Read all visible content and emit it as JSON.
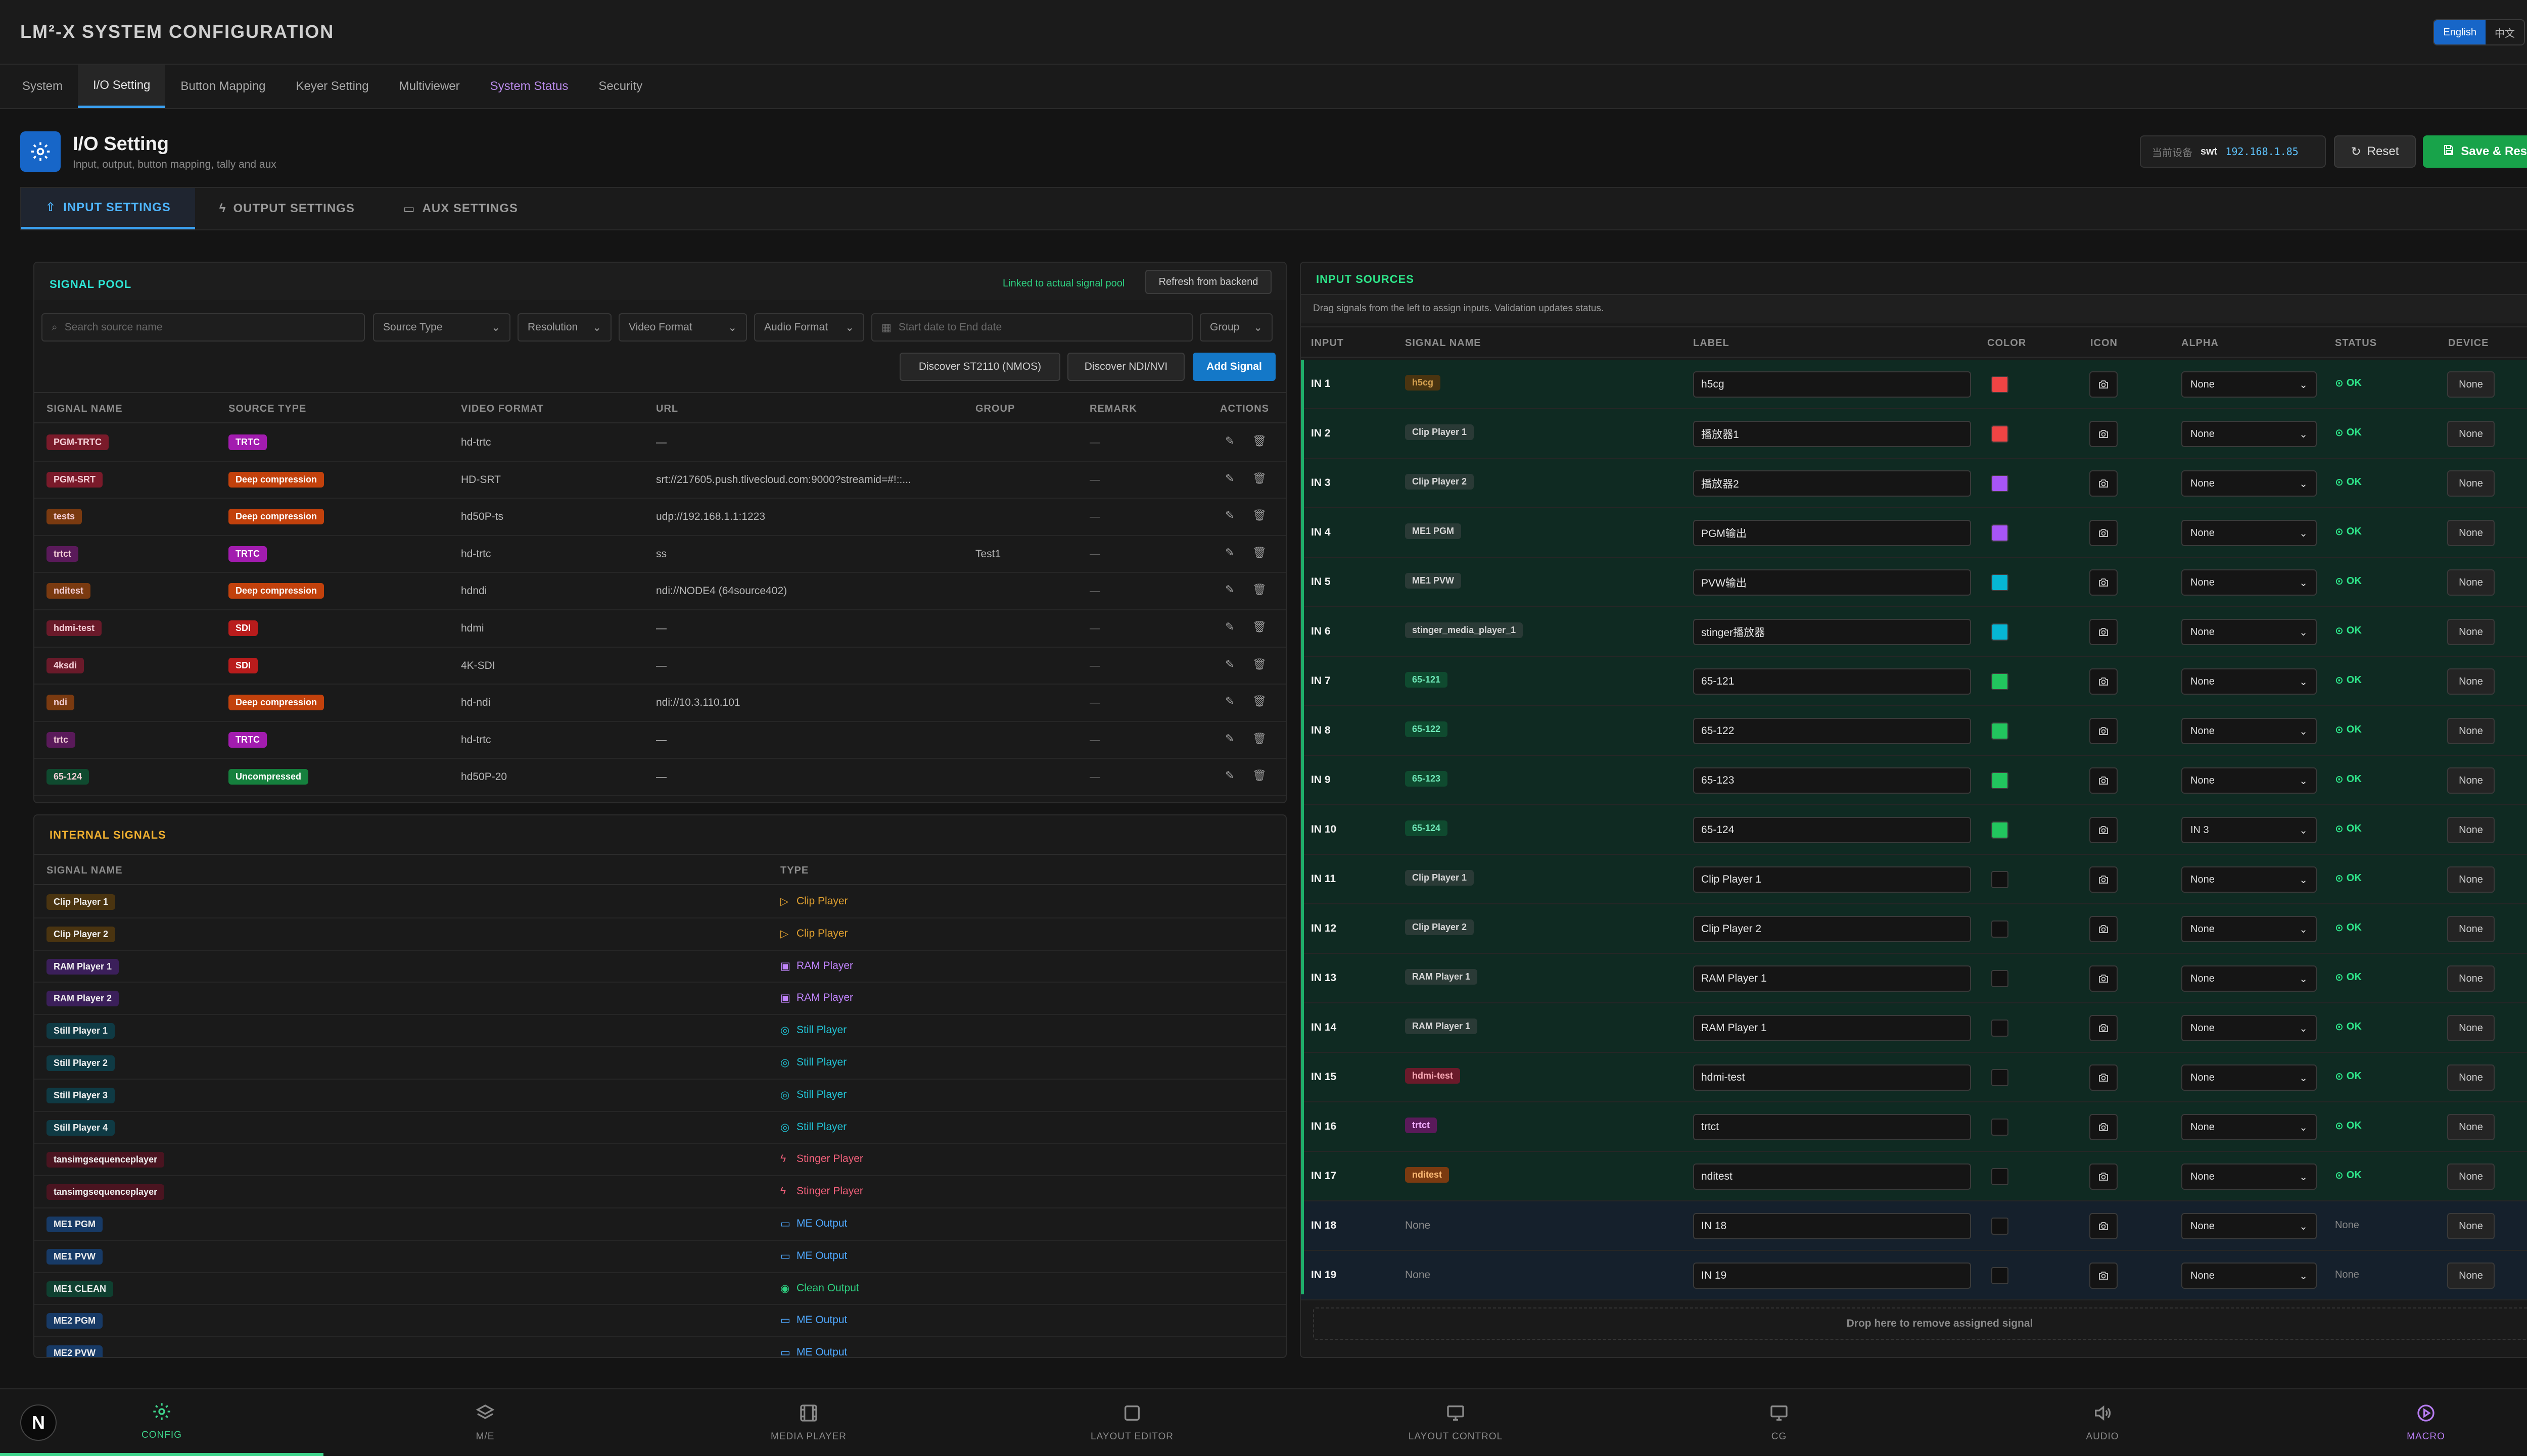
{
  "app": {
    "title": "LM²-X SYSTEM CONFIGURATION",
    "lang": [
      "English",
      "中文"
    ],
    "lang_active": "English"
  },
  "tabs": [
    "System",
    "I/O Setting",
    "Button Mapping",
    "Keyer Setting",
    "Multiviewer",
    "System Status",
    "Security"
  ],
  "tab_active": "I/O Setting",
  "page": {
    "title": "I/O Setting",
    "subtitle": "Input, output, button mapping, tally and aux",
    "device_label": "当前设备",
    "device": "swt",
    "ip": "192.168.1.85",
    "reset": "Reset",
    "save": "Save & Restart"
  },
  "subtabs": [
    "INPUT SETTINGS",
    "OUTPUT SETTINGS",
    "AUX SETTINGS"
  ],
  "signal_pool": {
    "title": "SIGNAL POOL",
    "linked": "Linked to actual signal pool",
    "refresh": "Refresh from backend",
    "search_placeholder": "Search source name",
    "filters": {
      "source_type": "Source Type",
      "resolution": "Resolution",
      "video_format": "Video Format",
      "audio_format": "Audio Format",
      "date": "Start date to End date",
      "group": "Group"
    },
    "buttons": {
      "discover_st": "Discover ST2110 (NMOS)",
      "discover_ndi": "Discover NDI/NVI",
      "add": "Add Signal"
    },
    "columns": [
      "SIGNAL NAME",
      "SOURCE TYPE",
      "VIDEO FORMAT",
      "URL",
      "GROUP",
      "REMARK",
      "ACTIONS"
    ],
    "rows": [
      {
        "name": "PGM-TRTC",
        "name_color": "#7a1a2a",
        "type": "TRTC",
        "type_color": "#a21caf",
        "format": "hd-trtc",
        "url": "—",
        "group": "",
        "remark": "—"
      },
      {
        "name": "PGM-SRT",
        "name_color": "#7a1a2a",
        "type": "Deep compression",
        "type_color": "#c2410c",
        "format": "HD-SRT",
        "url": "srt://217605.push.tlivecloud.com:9000?streamid=#!::...",
        "group": "",
        "remark": "—"
      },
      {
        "name": "tests",
        "name_color": "#7a3a10",
        "type": "Deep compression",
        "type_color": "#c2410c",
        "format": "hd50P-ts",
        "url": "udp://192.168.1.1:1223",
        "group": "",
        "remark": "—"
      },
      {
        "name": "trtct",
        "name_color": "#5a1a5a",
        "type": "TRTC",
        "type_color": "#a21caf",
        "format": "hd-trtc",
        "url": "ss",
        "group": "Test1",
        "remark": "—"
      },
      {
        "name": "nditest",
        "name_color": "#7a3a10",
        "type": "Deep compression",
        "type_color": "#c2410c",
        "format": "hdndi",
        "url": "ndi://NODE4 (64source402)",
        "group": "",
        "remark": "—"
      },
      {
        "name": "hdmi-test",
        "name_color": "#6a1a2a",
        "type": "SDI",
        "type_color": "#b91c1c",
        "format": "hdmi",
        "url": "—",
        "group": "",
        "remark": "—"
      },
      {
        "name": "4ksdi",
        "name_color": "#6a1a2a",
        "type": "SDI",
        "type_color": "#b91c1c",
        "format": "4K-SDI",
        "url": "—",
        "group": "",
        "remark": "—"
      },
      {
        "name": "ndi",
        "name_color": "#7a3a10",
        "type": "Deep compression",
        "type_color": "#c2410c",
        "format": "hd-ndi",
        "url": "ndi://10.3.110.101",
        "group": "",
        "remark": "—"
      },
      {
        "name": "trtc",
        "name_color": "#5a1a5a",
        "type": "TRTC",
        "type_color": "#a21caf",
        "format": "hd-trtc",
        "url": "—",
        "group": "",
        "remark": "—"
      },
      {
        "name": "65-124",
        "name_color": "#0f4a2f",
        "type": "Uncompressed",
        "type_color": "#15803d",
        "format": "hd50P-20",
        "url": "—",
        "group": "",
        "remark": "—"
      }
    ]
  },
  "internal": {
    "title": "INTERNAL SIGNALS",
    "columns": [
      "SIGNAL NAME",
      "TYPE"
    ],
    "rows": [
      {
        "name": "Clip Player 1",
        "type": "Clip Player",
        "color": "#e0a030",
        "bg": "#4a3410",
        "icon": "▷"
      },
      {
        "name": "Clip Player 2",
        "type": "Clip Player",
        "color": "#e0a030",
        "bg": "#4a3410",
        "icon": "▷"
      },
      {
        "name": "RAM Player 1",
        "type": "RAM Player",
        "color": "#c084fc",
        "bg": "#3b1f5a",
        "icon": "▣"
      },
      {
        "name": "RAM Player 2",
        "type": "RAM Player",
        "color": "#c084fc",
        "bg": "#3b1f5a",
        "icon": "▣"
      },
      {
        "name": "Still Player 1",
        "type": "Still Player",
        "color": "#22c4d6",
        "bg": "#0f3a44",
        "icon": "◎"
      },
      {
        "name": "Still Player 2",
        "type": "Still Player",
        "color": "#22c4d6",
        "bg": "#0f3a44",
        "icon": "◎"
      },
      {
        "name": "Still Player 3",
        "type": "Still Player",
        "color": "#22c4d6",
        "bg": "#0f3a44",
        "icon": "◎"
      },
      {
        "name": "Still Player 4",
        "type": "Still Player",
        "color": "#22c4d6",
        "bg": "#0f3a44",
        "icon": "◎"
      },
      {
        "name": "tansimgsequenceplayer",
        "type": "Stinger Player",
        "color": "#f0607a",
        "bg": "#4a1420",
        "icon": "ϟ"
      },
      {
        "name": "tansimgsequenceplayer",
        "type": "Stinger Player",
        "color": "#f0607a",
        "bg": "#4a1420",
        "icon": "ϟ"
      },
      {
        "name": "ME1 PGM",
        "type": "ME Output",
        "color": "#4fa8ff",
        "bg": "#173a66",
        "icon": "▭"
      },
      {
        "name": "ME1 PVW",
        "type": "ME Output",
        "color": "#4fa8ff",
        "bg": "#173a66",
        "icon": "▭"
      },
      {
        "name": "ME1 CLEAN",
        "type": "Clean Output",
        "color": "#2ecf80",
        "bg": "#0f4030",
        "icon": "◉"
      },
      {
        "name": "ME2 PGM",
        "type": "ME Output",
        "color": "#4fa8ff",
        "bg": "#173a66",
        "icon": "▭"
      },
      {
        "name": "ME2 PVW",
        "type": "ME Output",
        "color": "#4fa8ff",
        "bg": "#173a66",
        "icon": "▭"
      }
    ]
  },
  "input_sources": {
    "title": "INPUT SOURCES",
    "hint": "Drag signals from the left to assign inputs. Validation updates status.",
    "columns": [
      "INPUT",
      "SIGNAL NAME",
      "LABEL",
      "COLOR",
      "ICON",
      "ALPHA",
      "STATUS",
      "DEVICE"
    ],
    "drop": "Drop here to remove assigned signal",
    "rows": [
      {
        "input": "IN 1",
        "signal": "h5cg",
        "sig_color": "#d4a050",
        "sig_bg": "#4a3410",
        "label": "h5cg",
        "color": "#ef4444",
        "alpha": "None",
        "status": "OK",
        "device": "None"
      },
      {
        "input": "IN 2",
        "signal": "Clip Player 1",
        "sig_color": "#d6d6d6",
        "sig_bg": "#2a3a36",
        "label": "播放器1",
        "color": "#ef4444",
        "alpha": "None",
        "status": "OK",
        "device": "None"
      },
      {
        "input": "IN 3",
        "signal": "Clip Player 2",
        "sig_color": "#d6d6d6",
        "sig_bg": "#2a3a36",
        "label": "播放器2",
        "color": "#a855f7",
        "alpha": "None",
        "status": "OK",
        "device": "None"
      },
      {
        "input": "IN 4",
        "signal": "ME1 PGM",
        "sig_color": "#d6d6d6",
        "sig_bg": "#2a3a36",
        "label": "PGM输出",
        "color": "#a855f7",
        "alpha": "None",
        "status": "OK",
        "device": "None"
      },
      {
        "input": "IN 5",
        "signal": "ME1 PVW",
        "sig_color": "#d6d6d6",
        "sig_bg": "#2a3a36",
        "label": "PVW输出",
        "color": "#06b6d4",
        "alpha": "None",
        "status": "OK",
        "device": "None"
      },
      {
        "input": "IN 6",
        "signal": "stinger_media_player_1",
        "sig_color": "#d6d6d6",
        "sig_bg": "#2a3a36",
        "label": "stinger播放器",
        "color": "#06b6d4",
        "alpha": "None",
        "status": "OK",
        "device": "None"
      },
      {
        "input": "IN 7",
        "signal": "65-121",
        "sig_color": "#6ee7b7",
        "sig_bg": "#0f4a2f",
        "label": "65-121",
        "color": "#22c55e",
        "alpha": "None",
        "status": "OK",
        "device": "None"
      },
      {
        "input": "IN 8",
        "signal": "65-122",
        "sig_color": "#6ee7b7",
        "sig_bg": "#0f4a2f",
        "label": "65-122",
        "color": "#22c55e",
        "alpha": "None",
        "status": "OK",
        "device": "None"
      },
      {
        "input": "IN 9",
        "signal": "65-123",
        "sig_color": "#6ee7b7",
        "sig_bg": "#0f4a2f",
        "label": "65-123",
        "color": "#22c55e",
        "alpha": "None",
        "status": "OK",
        "device": "None"
      },
      {
        "input": "IN 10",
        "signal": "65-124",
        "sig_color": "#6ee7b7",
        "sig_bg": "#0f4a2f",
        "label": "65-124",
        "color": "#22c55e",
        "alpha": "IN 3",
        "status": "OK",
        "device": "None"
      },
      {
        "input": "IN 11",
        "signal": "Clip Player 1",
        "sig_color": "#d6d6d6",
        "sig_bg": "#2a3a36",
        "label": "Clip Player 1",
        "color": "#111111",
        "alpha": "None",
        "status": "OK",
        "device": "None"
      },
      {
        "input": "IN 12",
        "signal": "Clip Player 2",
        "sig_color": "#d6d6d6",
        "sig_bg": "#2a3a36",
        "label": "Clip Player 2",
        "color": "#111111",
        "alpha": "None",
        "status": "OK",
        "device": "None"
      },
      {
        "input": "IN 13",
        "signal": "RAM Player 1",
        "sig_color": "#d6d6d6",
        "sig_bg": "#2a3a36",
        "label": "RAM Player 1",
        "color": "#111111",
        "alpha": "None",
        "status": "OK",
        "device": "None"
      },
      {
        "input": "IN 14",
        "signal": "RAM Player 1",
        "sig_color": "#d6d6d6",
        "sig_bg": "#2a3a36",
        "label": "RAM Player 1",
        "color": "#111111",
        "alpha": "None",
        "status": "OK",
        "device": "None"
      },
      {
        "input": "IN 15",
        "signal": "hdmi-test",
        "sig_color": "#f9a8b4",
        "sig_bg": "#6a1a2a",
        "label": "hdmi-test",
        "color": "#111111",
        "alpha": "None",
        "status": "OK",
        "device": "None"
      },
      {
        "input": "IN 16",
        "signal": "trtct",
        "sig_color": "#f0abfc",
        "sig_bg": "#5a1a5a",
        "label": "trtct",
        "color": "#111111",
        "alpha": "None",
        "status": "OK",
        "device": "None"
      },
      {
        "input": "IN 17",
        "signal": "nditest",
        "sig_color": "#fdba74",
        "sig_bg": "#7a3a10",
        "label": "nditest",
        "color": "#111111",
        "alpha": "None",
        "status": "OK",
        "device": "None"
      },
      {
        "input": "IN 18",
        "signal": "None",
        "sig_color": "#8a8a8a",
        "sig_bg": "",
        "label": "IN 18",
        "color": "#111111",
        "alpha": "None",
        "status": "None",
        "device": "None"
      },
      {
        "input": "IN 19",
        "signal": "None",
        "sig_color": "#8a8a8a",
        "sig_bg": "",
        "label": "IN 19",
        "color": "#111111",
        "alpha": "None",
        "status": "None",
        "device": "None"
      }
    ]
  },
  "bottom_nav": [
    "CONFIG",
    "M/E",
    "MEDIA PLAYER",
    "LAYOUT EDITOR",
    "LAYOUT CONTROL",
    "CG",
    "AUDIO",
    "MACRO"
  ],
  "bottom_active": "CONFIG",
  "logo": "N",
  "colors": {
    "accent_blue": "#1766c8",
    "ok_green": "#2ee68a",
    "save_green": "#18a34a",
    "pool_title": "#2ee6d6",
    "internal_title": "#f0b030",
    "input_title": "#2ee68a"
  }
}
